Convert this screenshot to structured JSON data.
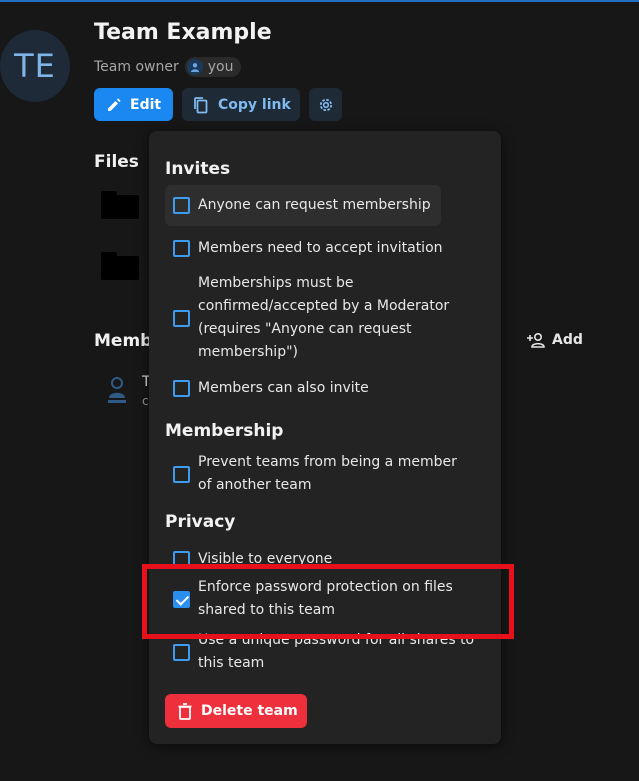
{
  "team": {
    "initials": "TE",
    "title": "Team Example",
    "owner_label": "Team owner",
    "owner_value": "you"
  },
  "actions": {
    "edit_label": "Edit",
    "copy_link_label": "Copy link"
  },
  "files": {
    "heading": "Files"
  },
  "members": {
    "heading": "Memb",
    "add_label": "Add",
    "first_member_initial": "T",
    "first_member_sub": "c"
  },
  "settings": {
    "invites": {
      "heading": "Invites",
      "options": [
        {
          "label": "Anyone can request membership",
          "checked": false
        },
        {
          "label": "Members need to accept invitation",
          "checked": false
        },
        {
          "label": "Memberships must be confirmed/accepted by a Moderator (requires \"Anyone can request membership\")",
          "checked": false
        },
        {
          "label": "Members can also invite",
          "checked": false
        }
      ]
    },
    "membership": {
      "heading": "Membership",
      "options": [
        {
          "label": "Prevent teams from being a member of another team",
          "checked": false
        }
      ]
    },
    "privacy": {
      "heading": "Privacy",
      "options": [
        {
          "label": "Visible to everyone",
          "checked": false
        },
        {
          "label": "Enforce password protection on files shared to this team",
          "checked": true
        },
        {
          "label": "Use a unique password for all shares to this team",
          "checked": false
        }
      ]
    },
    "delete_label": "Delete team"
  },
  "colors": {
    "primary": "#1a88f0",
    "danger": "#ee2f3c",
    "highlight_box": "#e8101b",
    "background": "#171717"
  }
}
